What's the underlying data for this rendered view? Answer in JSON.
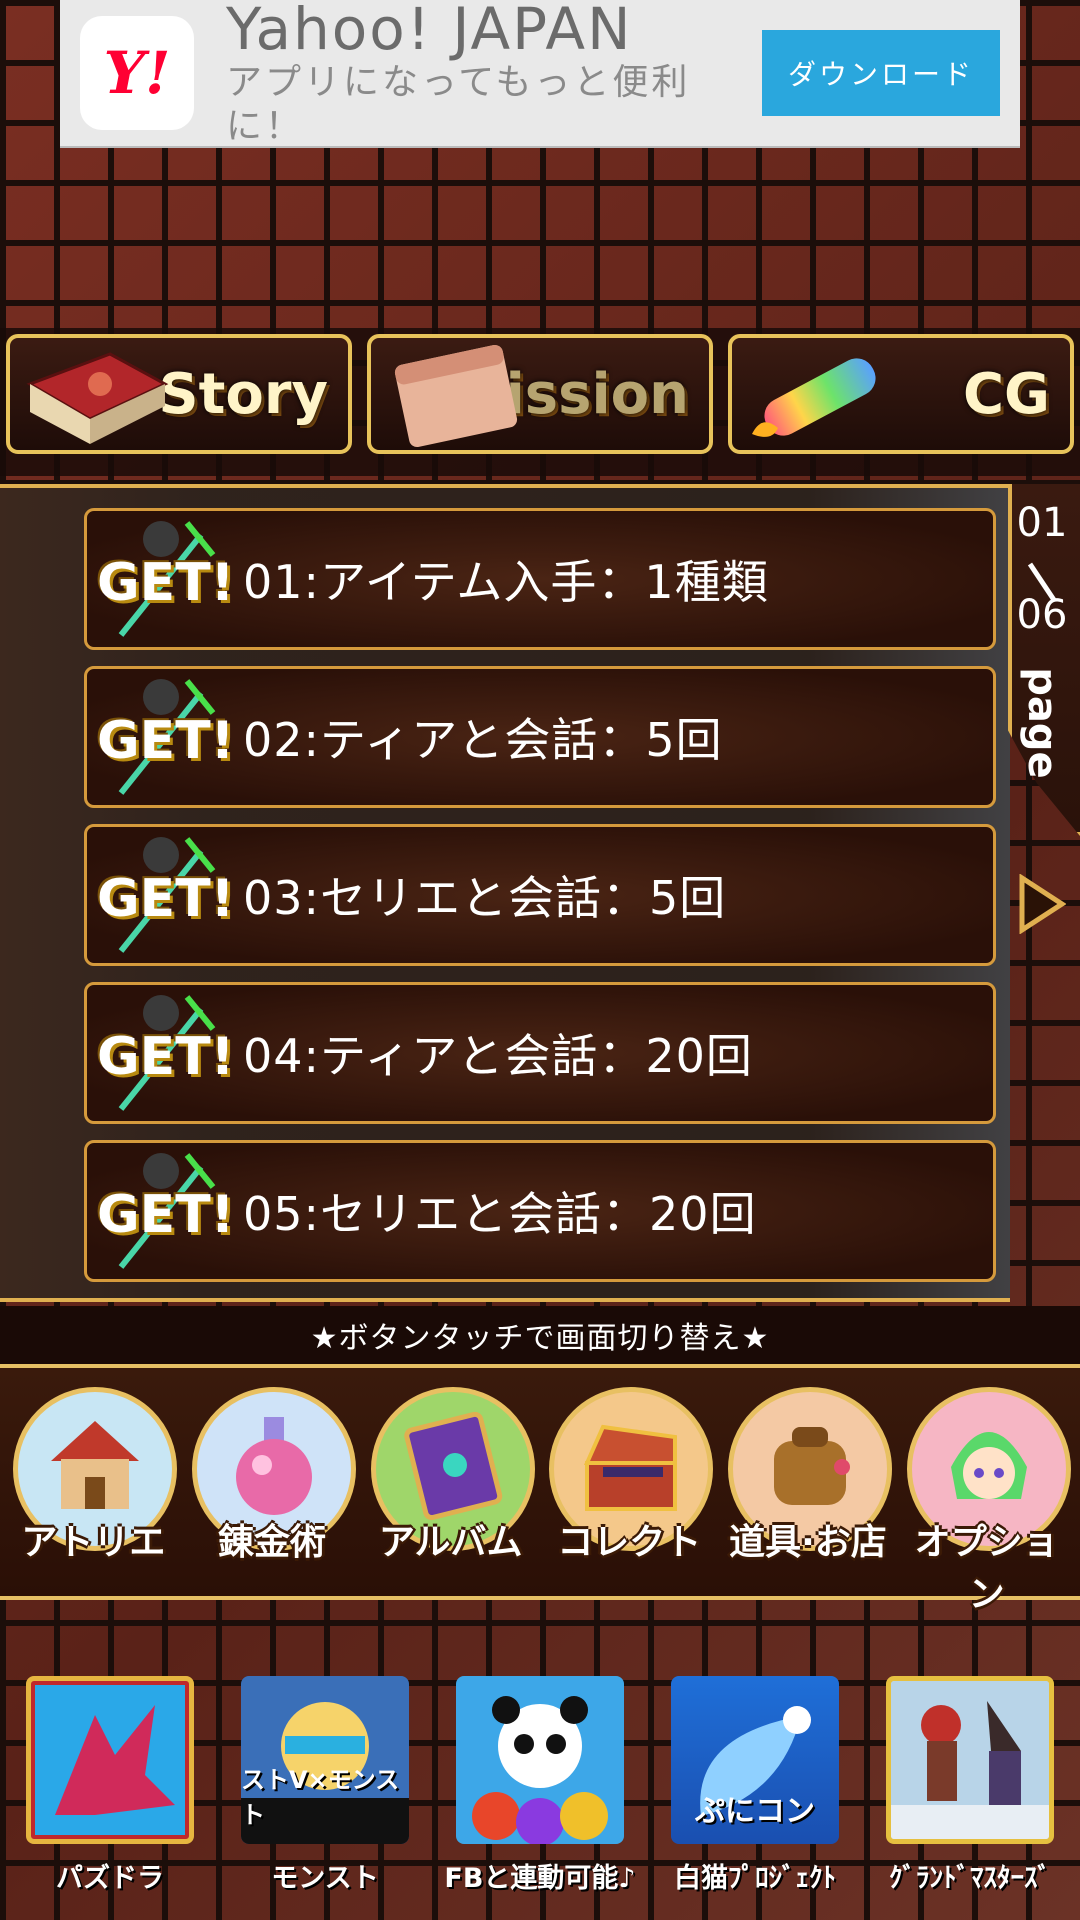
{
  "ad": {
    "logo": "Y!",
    "title": "Yahoo! JAPAN",
    "subtitle": "アプリになってもっと便利に！",
    "button": "ダウンロード"
  },
  "tabs": [
    {
      "label": "Story",
      "icon": "book-icon"
    },
    {
      "label": "Mission",
      "icon": "scroll-icon"
    },
    {
      "label": "CG",
      "icon": "rainbow-scroll-icon"
    }
  ],
  "missions": [
    {
      "badge": "GET!",
      "label": "01:アイテム入手：1種類"
    },
    {
      "badge": "GET!",
      "label": "02:ティアと会話：5回"
    },
    {
      "badge": "GET!",
      "label": "03:セリエと会話：5回"
    },
    {
      "badge": "GET!",
      "label": "04:ティアと会話：20回"
    },
    {
      "badge": "GET!",
      "label": "05:セリエと会話：20回"
    }
  ],
  "pagination": {
    "current": "01",
    "total": "06",
    "word": "page"
  },
  "hint": "★ボタンタッチで画面切り替え★",
  "menu": [
    {
      "label": "アトリエ",
      "icon": "house-icon",
      "ring": "#f0c060",
      "bg": "#c8e6f4"
    },
    {
      "label": "錬金術",
      "icon": "potion-icon",
      "ring": "#f0c060",
      "bg": "#cfe3f8"
    },
    {
      "label": "アルバム",
      "icon": "album-icon",
      "ring": "#f0c060",
      "bg": "#9fd66a"
    },
    {
      "label": "コレクト",
      "icon": "chest-icon",
      "ring": "#f0c060",
      "bg": "#f4c88a"
    },
    {
      "label": "道具·お店",
      "icon": "bag-icon",
      "ring": "#f0c060",
      "bg": "#f4c9a4"
    },
    {
      "label": "オプション",
      "icon": "character-icon",
      "ring": "#f0c060",
      "bg": "#f6b6c4"
    }
  ],
  "apps": [
    {
      "label": "パズドラ",
      "inner": "",
      "bg": "#c0282c"
    },
    {
      "label": "モンスト",
      "inner": "ストV×モンスト",
      "bg": "#3a6fb8"
    },
    {
      "label": "FBと連動可能♪",
      "inner": "",
      "bg": "#3da7e8"
    },
    {
      "label": "白猫ﾌﾟﾛｼﾞｪｸﾄ",
      "inner": "ぷにコン",
      "bg": "#1f6fd8"
    },
    {
      "label": "ｸﾞﾗﾝﾄﾞﾏｽﾀｰｽﾞ",
      "inner": "",
      "bg": "#cfd8de"
    }
  ]
}
